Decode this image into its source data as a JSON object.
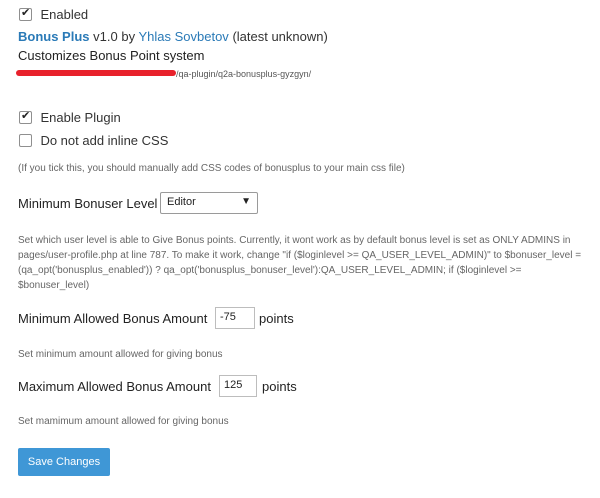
{
  "plugin": {
    "enabled_label": "Enabled",
    "name": "Bonus Plus",
    "version": "v1.0",
    "by": "by",
    "author": "Yhlas Sovbetov",
    "version_status": "(latest unknown)",
    "description": "Customizes Bonus Point system",
    "path_suffix": "/qa-plugin/q2a-bonusplus-gyzgyn/"
  },
  "options": {
    "enable_plugin_label": "Enable Plugin",
    "no_inline_css_label": "Do not add inline CSS",
    "inline_css_help": "(If you tick this, you should manually add CSS codes of bonusplus to your main css file)",
    "min_level": {
      "label": "Minimum Bonuser Level",
      "selected": "Editor",
      "help": "Set which user level is able to Give Bonus points. Currently, it wont work as by default bonus level is set as ONLY ADMINS in pages/user-profile.php at line 787. To make it work, change \"if ($loginlevel >= QA_USER_LEVEL_ADMIN)\" to $bonuser_level = (qa_opt('bonusplus_enabled')) ? qa_opt('bonusplus_bonuser_level'):QA_USER_LEVEL_ADMIN; if ($loginlevel >= $bonuser_level)"
    },
    "min_amount": {
      "label": "Minimum Allowed Bonus Amount",
      "value": "-75",
      "unit": "points",
      "help": "Set minimum amount allowed for giving bonus"
    },
    "max_amount": {
      "label": "Maximum Allowed Bonus Amount",
      "value": "125",
      "unit": "points",
      "help": "Set mamimum amount allowed for giving bonus"
    },
    "save_label": "Save Changes"
  },
  "colors": {
    "link": "#2a7ab7",
    "button": "#3f97d6",
    "redaction": "#e8212b"
  }
}
